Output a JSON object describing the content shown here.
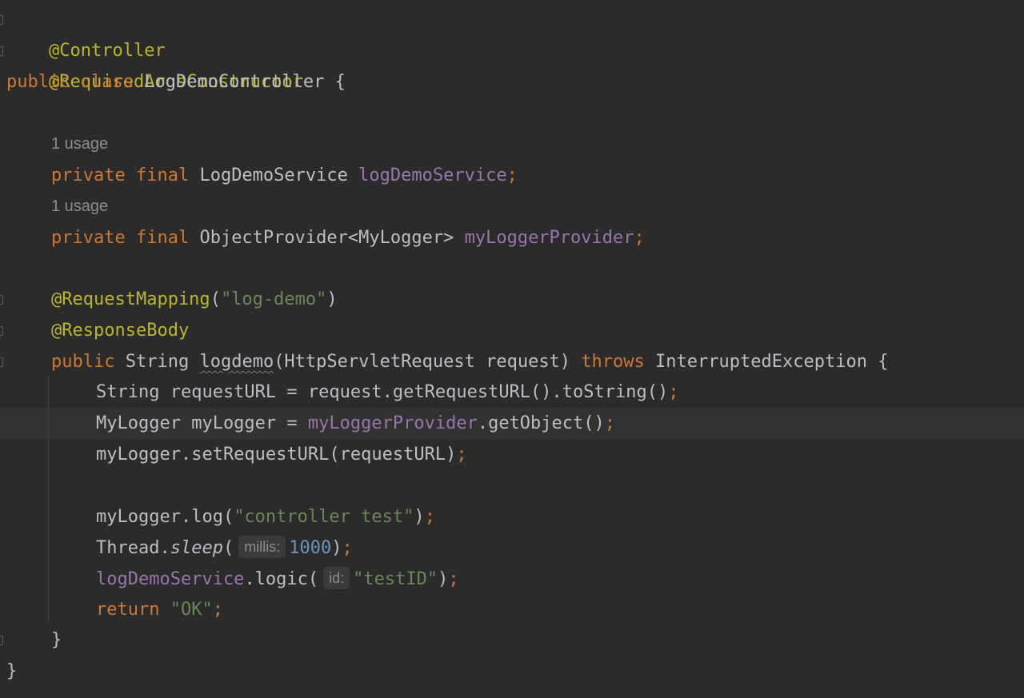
{
  "code": {
    "line1": {
      "annotation": "@Controller"
    },
    "line2": {
      "annotation": "@RequiredArgsConstructor"
    },
    "line3": {
      "kw_public": "public",
      "kw_class": "class",
      "class_name": "LogDemoController",
      "brace": "{"
    },
    "usage_hint_1": "1 usage",
    "line5": {
      "kw_private": "private",
      "kw_final": "final",
      "type": "LogDemoService",
      "field": "logDemoService",
      "semi": ";"
    },
    "usage_hint_2": "1 usage",
    "line7": {
      "kw_private": "private",
      "kw_final": "final",
      "type": "ObjectProvider<MyLogger>",
      "field": "myLoggerProvider",
      "semi": ";"
    },
    "line9": {
      "annotation": "@RequestMapping",
      "open": "(",
      "string": "\"log-demo\"",
      "close": ")"
    },
    "line10": {
      "annotation": "@ResponseBody"
    },
    "line11": {
      "kw_public": "public",
      "type": "String",
      "method": "logdemo",
      "params": "(HttpServletRequest request)",
      "kw_throws": "throws",
      "exception": "InterruptedException",
      "brace": "{"
    },
    "line12": {
      "text": "String requestURL = request.getRequestURL().toString()",
      "semi": ";"
    },
    "line13": {
      "decl": "MyLogger myLogger = ",
      "field": "myLoggerProvider",
      "call": ".getObject()",
      "semi": ";"
    },
    "line14": {
      "text": "myLogger.setRequestURL(requestURL)",
      "semi": ";"
    },
    "line16": {
      "call": "myLogger.log(",
      "string": "\"controller test\"",
      "close": ")",
      "semi": ";"
    },
    "line17": {
      "prefix": "Thread.",
      "method": "sleep",
      "open": "(",
      "hint": "millis:",
      "number": "1000",
      "close": ")",
      "semi": ";"
    },
    "line18": {
      "field": "logDemoService",
      "call": ".logic(",
      "hint": "id:",
      "string": "\"testID\"",
      "close": ")",
      "semi": ";"
    },
    "line19": {
      "kw_return": "return",
      "string": "\"OK\"",
      "semi": ";"
    },
    "line20": {
      "brace": "}"
    },
    "line21": {
      "brace": "}"
    }
  },
  "colors": {
    "background": "#2b2b2b",
    "keyword": "#cc7832",
    "annotation": "#bbb529",
    "string": "#6a8759",
    "field": "#9876aa",
    "number": "#6897bb",
    "text": "#bcbec4",
    "hint": "#8c8c8c"
  }
}
